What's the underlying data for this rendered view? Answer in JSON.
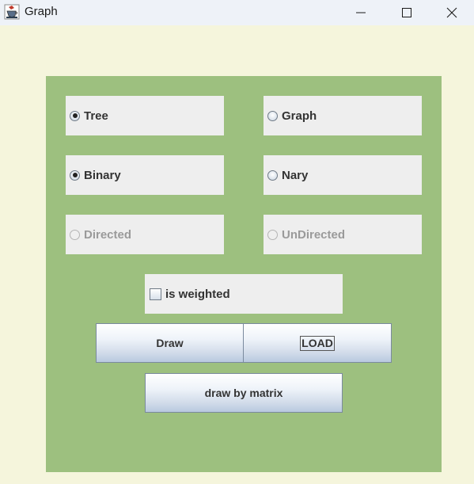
{
  "window": {
    "title": "Graph",
    "app_icon": "java-cup-icon"
  },
  "options": {
    "tree": {
      "label": "Tree",
      "checked": true
    },
    "graph": {
      "label": "Graph",
      "checked": false
    },
    "binary": {
      "label": "Binary",
      "checked": true
    },
    "nary": {
      "label": "Nary",
      "checked": false
    },
    "directed": {
      "label": "Directed",
      "checked": false,
      "enabled": false
    },
    "undirected": {
      "label": "UnDirected",
      "checked": false,
      "enabled": false
    },
    "weighted": {
      "label": "is weighted",
      "checked": false
    }
  },
  "buttons": {
    "draw": "Draw",
    "load": "LOAD",
    "draw_matrix": "draw by matrix"
  },
  "colors": {
    "background": "#f5f5dc",
    "panel": "#9dc07f",
    "option_bg": "#eeeeee"
  }
}
